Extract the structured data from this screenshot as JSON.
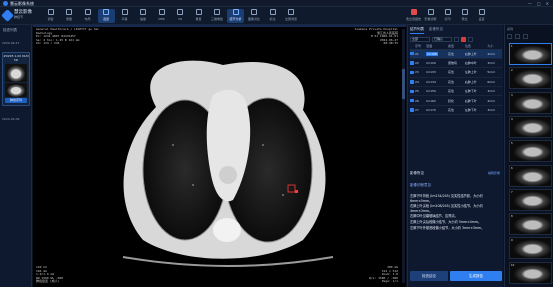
{
  "window": {
    "title": "慧云影像系统",
    "controls": [
      "—",
      "□",
      "✕"
    ]
  },
  "brand": {
    "name": "慧云影像",
    "sub": "肺结节"
  },
  "toolbar": {
    "tools": [
      {
        "label": "调窗",
        "icon": "window-icon"
      },
      {
        "label": "测量",
        "icon": "ruler-icon"
      },
      {
        "label": "布局",
        "icon": "layout-icon"
      },
      {
        "label": "选层",
        "icon": "layers-icon",
        "active": true
      },
      {
        "label": "平移",
        "icon": "pan-icon"
      },
      {
        "label": "缩放",
        "icon": "zoom-icon"
      },
      {
        "label": "MPR",
        "icon": "mpr-icon"
      },
      {
        "label": "VR",
        "icon": "vr-icon"
      },
      {
        "label": "重置",
        "icon": "reset-icon"
      },
      {
        "label": "三维重建",
        "icon": "cube-icon"
      },
      {
        "label": "结节分析",
        "icon": "analysis-icon",
        "active": true
      },
      {
        "label": "图像对比",
        "icon": "compare-icon"
      },
      {
        "label": "标注",
        "icon": "marker-icon"
      },
      {
        "label": "全屏浏览",
        "icon": "fullscreen-icon"
      }
    ],
    "right_tools": [
      {
        "label": "危急值报告",
        "icon": "alert-icon",
        "alert": true
      },
      {
        "label": "影像诊断",
        "icon": "diagnosis-icon"
      },
      {
        "label": "打印",
        "icon": "print-icon"
      },
      {
        "label": "导出",
        "icon": "export-icon"
      },
      {
        "label": "设置",
        "icon": "settings-icon"
      }
    ]
  },
  "left": {
    "title": "检查列表",
    "date1": "2024-06-27",
    "date2": "2024-05-09",
    "series": {
      "header": "#0295 1.00 DLM 5D",
      "button": "肺窗序列"
    }
  },
  "viewer": {
    "overlay_tl": [
      "General Healthcare / LIGHTCT gw 3ec",
      "Radiology",
      "Ex: 1232 AB67 84476457",
      "Se: 4 Slo: 1.25 B 161 mm",
      "Im: 134 / 245"
    ],
    "overlay_tr": [
      "Siemens Private Hospital",
      "浙江省人民医院",
      "M 51 1960-01-01",
      "2024-06-27",
      "08:48:35"
    ],
    "overlay_bl": [
      "120 kV",
      "196 mA",
      "1.0/1.0 mm",
      "WW 1500 WL -600",
      "肺窗窗宽 (成人)"
    ],
    "overlay_br": [
      "300 mm",
      "512 x 512",
      "Zoom: 1.0",
      "W/L: 1500 / -600",
      "Page: 1/1"
    ]
  },
  "rpanel": {
    "tabs": [
      "结节列表",
      "影像所见"
    ],
    "filter": [
      "全部",
      "已确认"
    ],
    "columns": [
      "序号",
      "层面",
      "类型",
      "位置",
      "大小"
    ],
    "rows": [
      {
        "id": "21",
        "slice": "Im108",
        "type": "实性",
        "loc": "右肺上叶",
        "size": "4mm",
        "selected": true
      },
      {
        "id": "22",
        "slice": "Im120",
        "type": "磨玻璃",
        "loc": "右肺中叶",
        "size": "3mm"
      },
      {
        "id": "23",
        "slice": "Im133",
        "type": "实性",
        "loc": "左肺上叶",
        "size": "5mm"
      },
      {
        "id": "24",
        "slice": "Im134",
        "type": "实性",
        "loc": "右肺上叶",
        "size": "6mm"
      },
      {
        "id": "25",
        "slice": "Im150",
        "type": "实性",
        "loc": "左肺下叶",
        "size": "3mm"
      },
      {
        "id": "26",
        "slice": "Im162",
        "type": "铙化",
        "loc": "右肺下叶",
        "size": "4mm"
      },
      {
        "id": "27",
        "slice": "Im170",
        "type": "实性",
        "loc": "左肺下叶",
        "size": "3mm"
      }
    ],
    "section1": "影像所见",
    "section1_link": "编辑影像",
    "section2": "影像诊断意见",
    "findings": [
      "左肺下叶背段 (Im134/245) 见实性结节影，大小约 6mm×5mm。",
      "右肺上叶尖段 (Im108/245) 见实性小结节，大小约 4mm×3mm。",
      "右肺中叶见磨玻璃结节，边界清。",
      "左肺上叶尖后段微小结节，大小约 5mm×4mm。",
      "左肺下叶外基底段微小结节，大小约 3mm×3mm。"
    ],
    "btn_secondary": "检查结论",
    "btn_primary": "生成报告"
  },
  "status_colors": [
    "#d93a3a",
    "#d93a3a",
    "#e88a2a",
    "#3aa64a",
    "#3aa64a",
    "#3aa64a",
    "#e88a2a"
  ],
  "farright": {
    "header": "系列",
    "thumbs": [
      "1",
      "2",
      "3",
      "4",
      "5",
      "6",
      "7",
      "8",
      "9",
      "10"
    ]
  }
}
